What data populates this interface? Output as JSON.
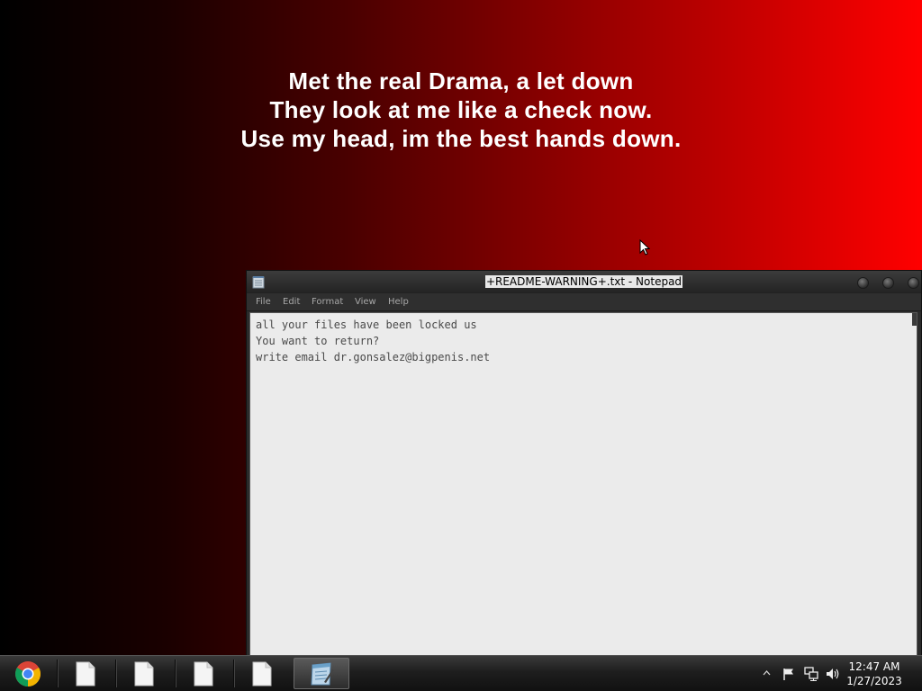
{
  "wallpaper": {
    "lines": [
      "Met the real Drama, a let down",
      "They look at me like a check now.",
      "Use my head, im the best hands down."
    ]
  },
  "notepad": {
    "title": "+README-WARNING+.txt - Notepad",
    "menu": [
      "File",
      "Edit",
      "Format",
      "View",
      "Help"
    ],
    "content_lines": [
      "all your files have been locked us",
      "You want to return?",
      "write email dr.gonsalez@bigpenis.net"
    ]
  },
  "taskbar": {
    "pinned": [
      "chrome-icon",
      "document-icon",
      "document-icon",
      "document-icon",
      "document-icon",
      "notepad-icon"
    ],
    "clock": {
      "time": "12:47 AM",
      "date": "1/27/2023"
    }
  },
  "colors": {
    "wallpaper_start": "#000000",
    "wallpaper_end": "#ff0000",
    "editor_bg": "#ebebeb",
    "window_chrome": "#2b2b2b"
  }
}
